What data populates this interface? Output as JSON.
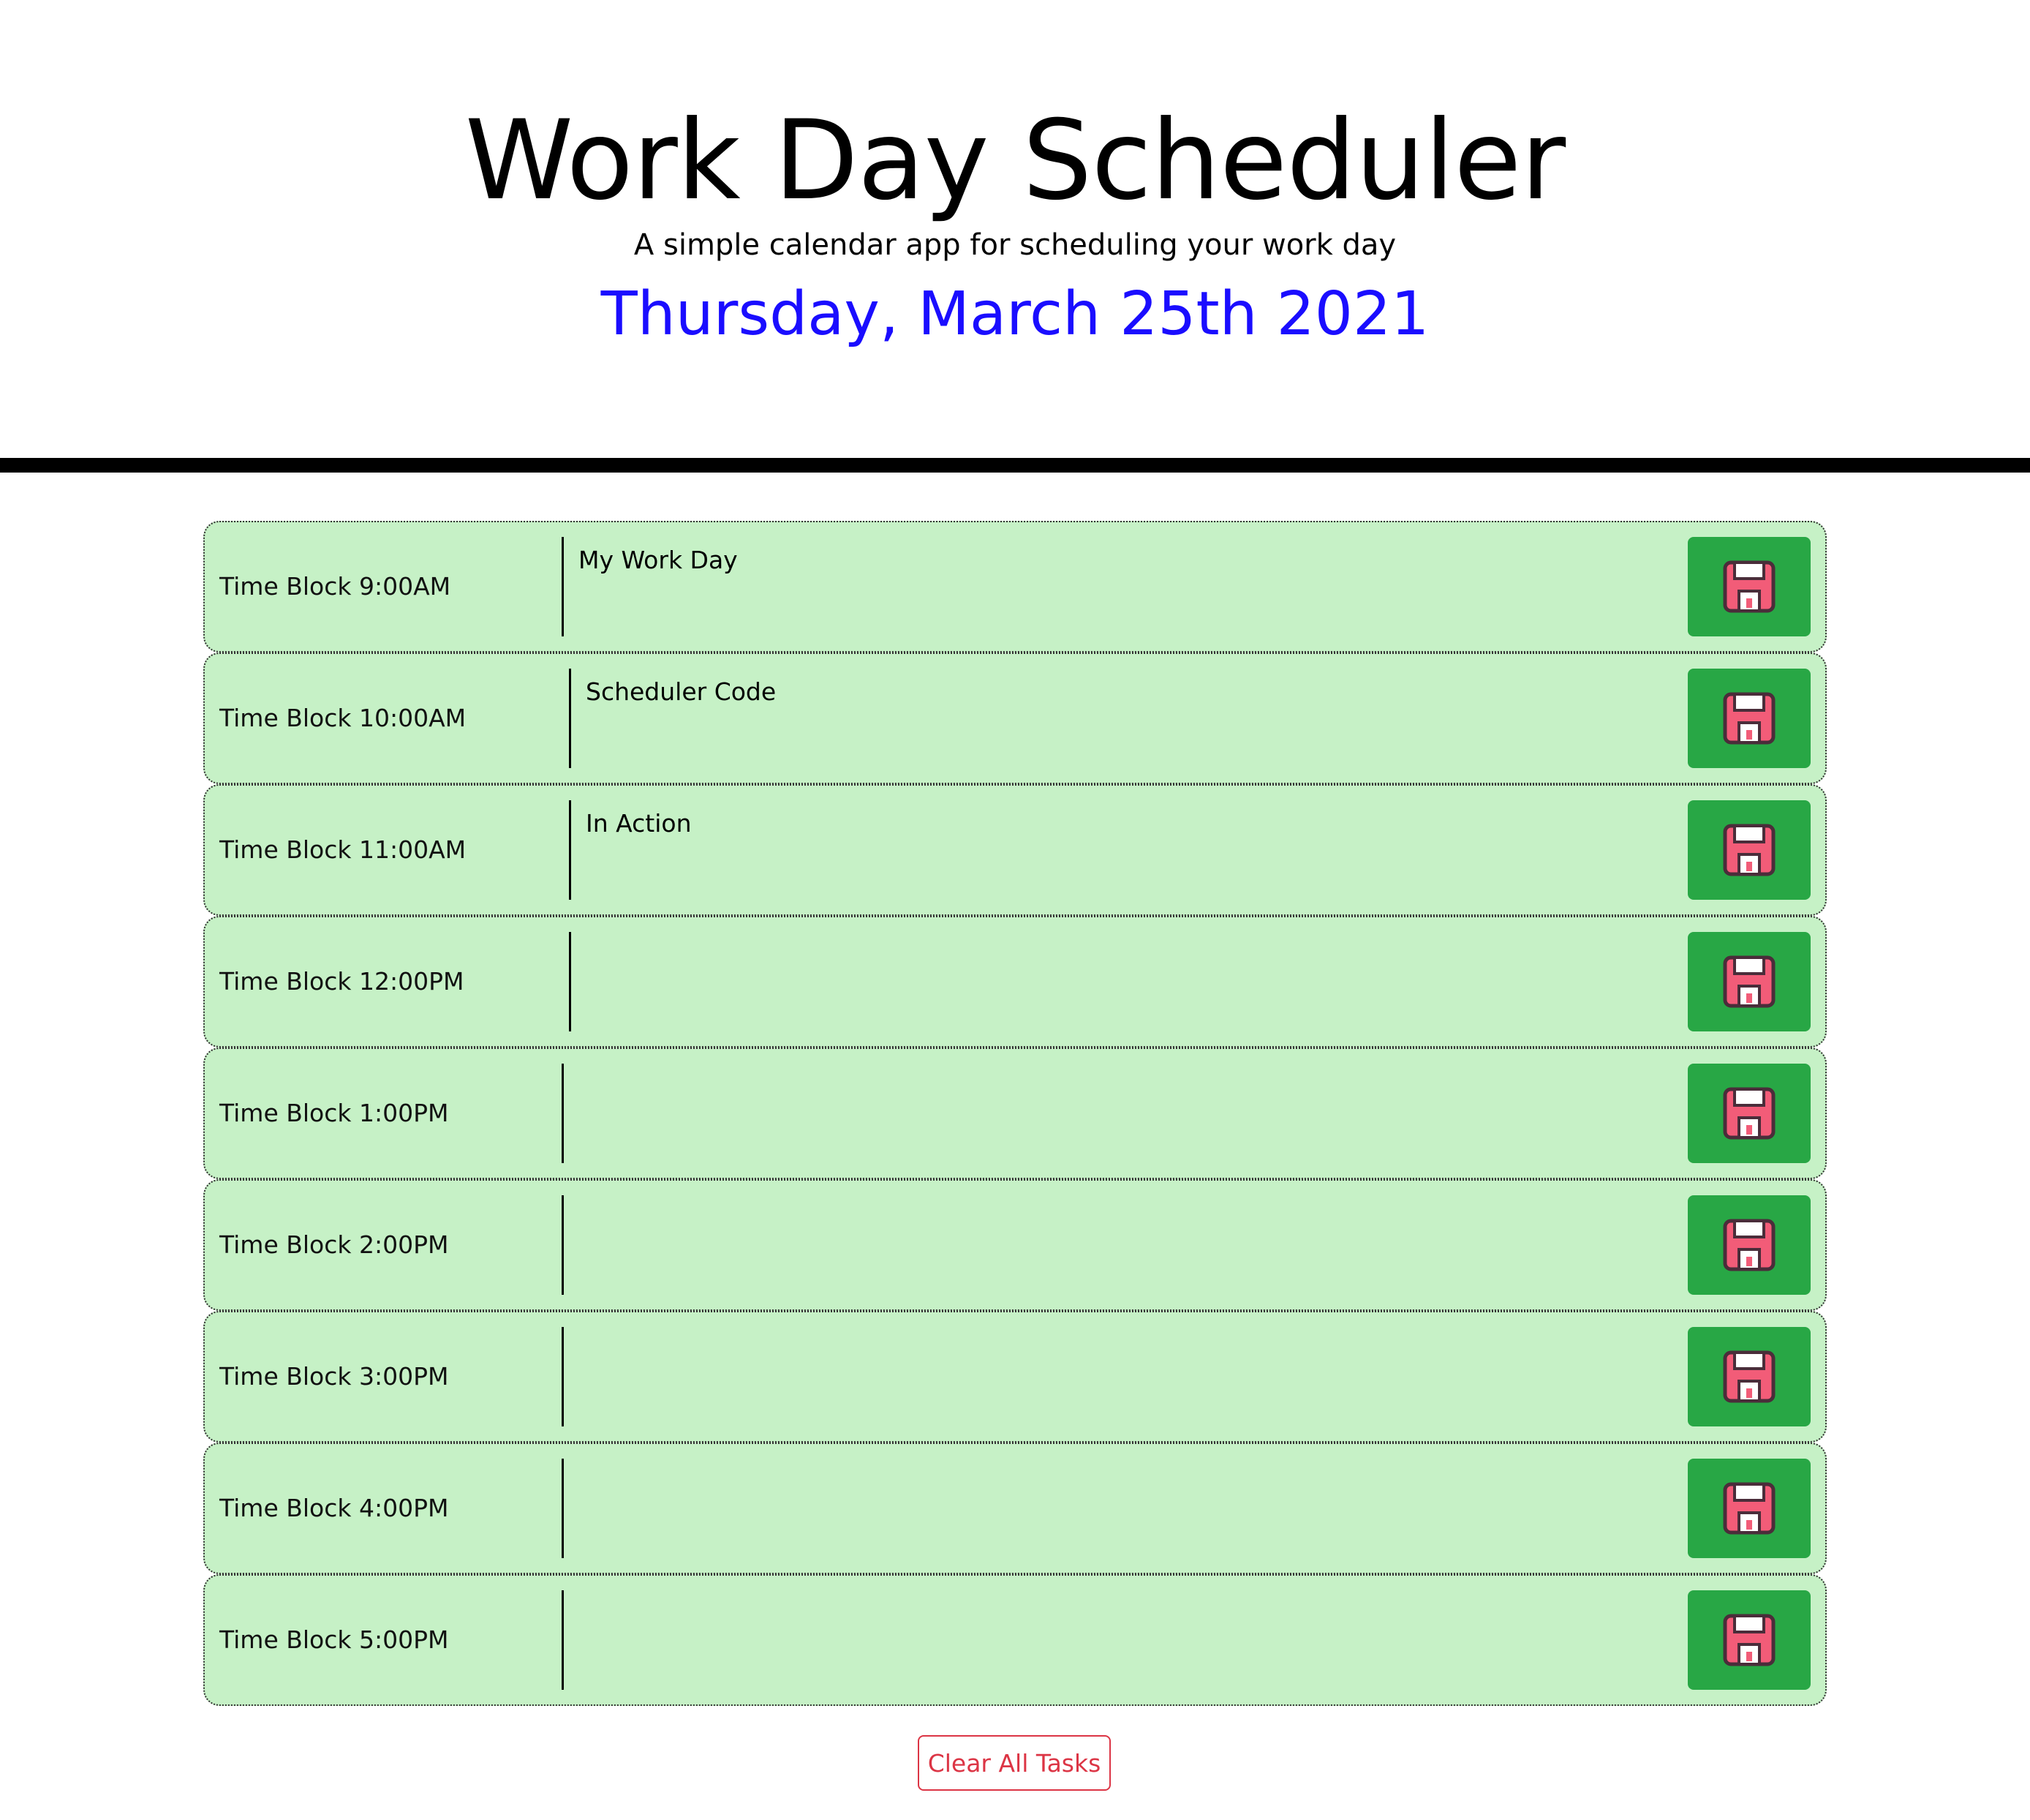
{
  "header": {
    "title": "Work Day Scheduler",
    "subtitle": "A simple calendar app for scheduling your work day",
    "date": "Thursday, March 25th 2021"
  },
  "colors": {
    "date": "#1a0dff",
    "row_background": "#c6f1c6",
    "save_button": "#28a745",
    "save_icon": "#f25c78",
    "clear_button": "#dc3545"
  },
  "time_blocks": [
    {
      "label": "Time Block 9:00AM",
      "task": "My Work Day"
    },
    {
      "label": "Time Block 10:00AM",
      "task": "Scheduler Code"
    },
    {
      "label": "Time Block 11:00AM",
      "task": "In Action"
    },
    {
      "label": "Time Block 12:00PM",
      "task": ""
    },
    {
      "label": "Time Block 1:00PM",
      "task": ""
    },
    {
      "label": "Time Block 2:00PM",
      "task": ""
    },
    {
      "label": "Time Block 3:00PM",
      "task": ""
    },
    {
      "label": "Time Block 4:00PM",
      "task": ""
    },
    {
      "label": "Time Block 5:00PM",
      "task": ""
    }
  ],
  "save_icon": "floppy-disk-icon",
  "clear_button": {
    "label": "Clear All Tasks"
  }
}
